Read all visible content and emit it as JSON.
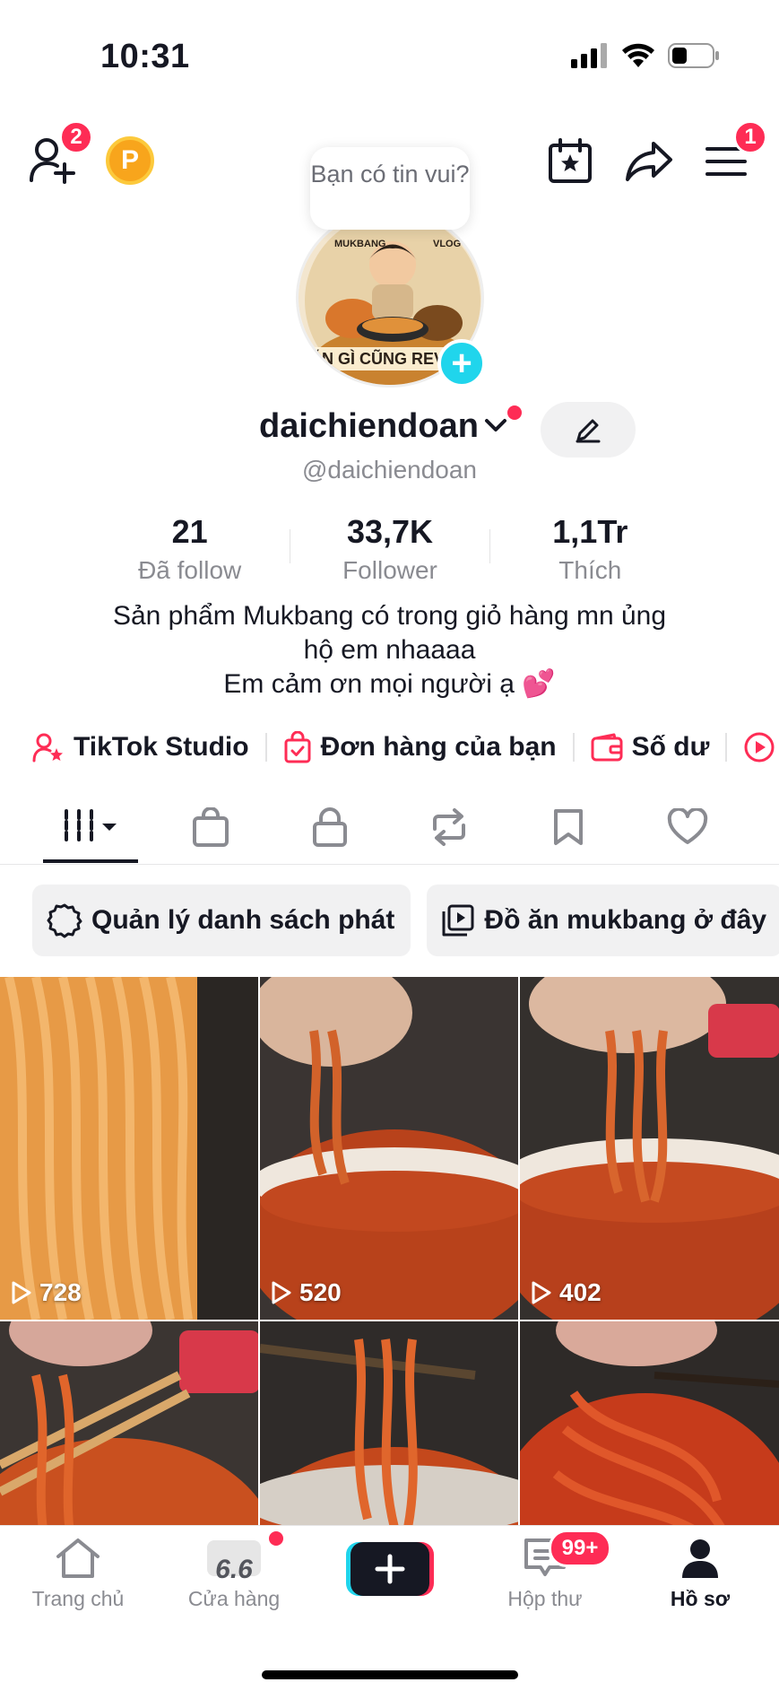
{
  "status_bar": {
    "time": "10:31"
  },
  "header": {
    "add_friends_badge": "2",
    "coin_label": "P",
    "menu_badge": "1",
    "bubble_text": "Bạn có tin vui?"
  },
  "avatar": {
    "plus_label": "+"
  },
  "profile": {
    "username": "daichiendoan",
    "handle": "@daichiendoan",
    "stats": [
      {
        "value": "21",
        "label": "Đã follow"
      },
      {
        "value": "33,7K",
        "label": "Follower"
      },
      {
        "value": "1,1Tr",
        "label": "Thích"
      }
    ],
    "bio_lines": [
      "Sản phẩm Mukbang có trong giỏ hàng mn ủng",
      "hộ em nhaaaa",
      "Em cảm ơn mọi người ạ 💕"
    ]
  },
  "quick_links": [
    {
      "label": "TikTok Studio",
      "icon": "person-star-icon"
    },
    {
      "label": "Đơn hàng của bạn",
      "icon": "shopping-bag-check-icon"
    },
    {
      "label": "Số dư",
      "icon": "wallet-icon"
    }
  ],
  "tabs": [
    {
      "name": "videos",
      "icon": "grid-icon",
      "active": true
    },
    {
      "name": "shop",
      "icon": "shopping-bag-icon"
    },
    {
      "name": "private",
      "icon": "lock-icon"
    },
    {
      "name": "reposts",
      "icon": "repost-icon"
    },
    {
      "name": "favorites",
      "icon": "bookmark-icon"
    },
    {
      "name": "liked",
      "icon": "heart-icon"
    }
  ],
  "chips": [
    {
      "label": "Quản lý danh sách phát",
      "icon": "gear-icon"
    },
    {
      "label": "Đồ ăn mukbang ở đây",
      "icon": "playlist-icon"
    }
  ],
  "videos": [
    {
      "views": "728"
    },
    {
      "views": "520"
    },
    {
      "views": "402"
    },
    {
      "views": ""
    },
    {
      "views": ""
    },
    {
      "views": ""
    }
  ],
  "bottom_nav": [
    {
      "label": "Trang chủ",
      "icon": "home-icon"
    },
    {
      "label": "Cửa hàng",
      "icon": "shop-icon",
      "badge_text": "6.6"
    },
    {
      "label": "",
      "icon": "plus-icon"
    },
    {
      "label": "Hộp thư",
      "icon": "inbox-icon",
      "badge": "99+"
    },
    {
      "label": "Hồ sơ",
      "icon": "profile-icon",
      "active": true
    }
  ],
  "colors": {
    "accent": "#fe2c55",
    "cyan": "#20d5ec",
    "text": "#161823",
    "muted": "#8a8b91"
  }
}
